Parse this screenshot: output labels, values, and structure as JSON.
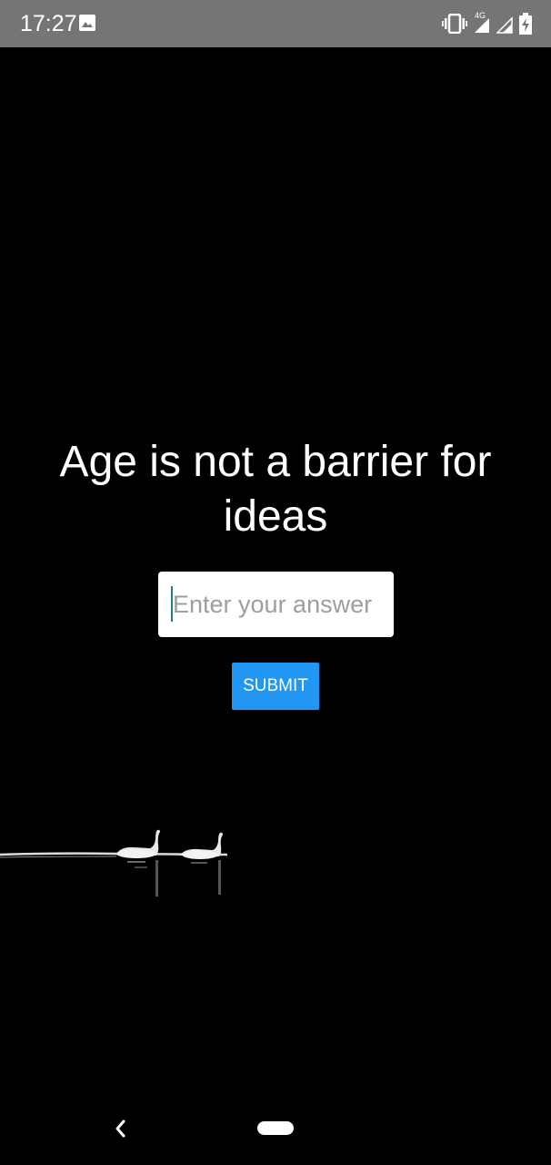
{
  "status_bar": {
    "time": "17:27",
    "network_label": "4G",
    "icons": [
      "image-icon",
      "vibrate-icon",
      "signal-icon",
      "signal-icon",
      "battery-charging-icon"
    ]
  },
  "main": {
    "headline": "Age is not a barrier for ideas",
    "answer_placeholder": "Enter your answer",
    "answer_value": "",
    "submit_label": "SUBMIT"
  },
  "colors": {
    "status_bar_bg": "#757575",
    "background": "#000000",
    "submit_bg": "#2196f3",
    "caret": "#1f7f7f"
  },
  "nav_bar": {
    "icons": [
      "back-icon",
      "home-pill-icon"
    ]
  }
}
